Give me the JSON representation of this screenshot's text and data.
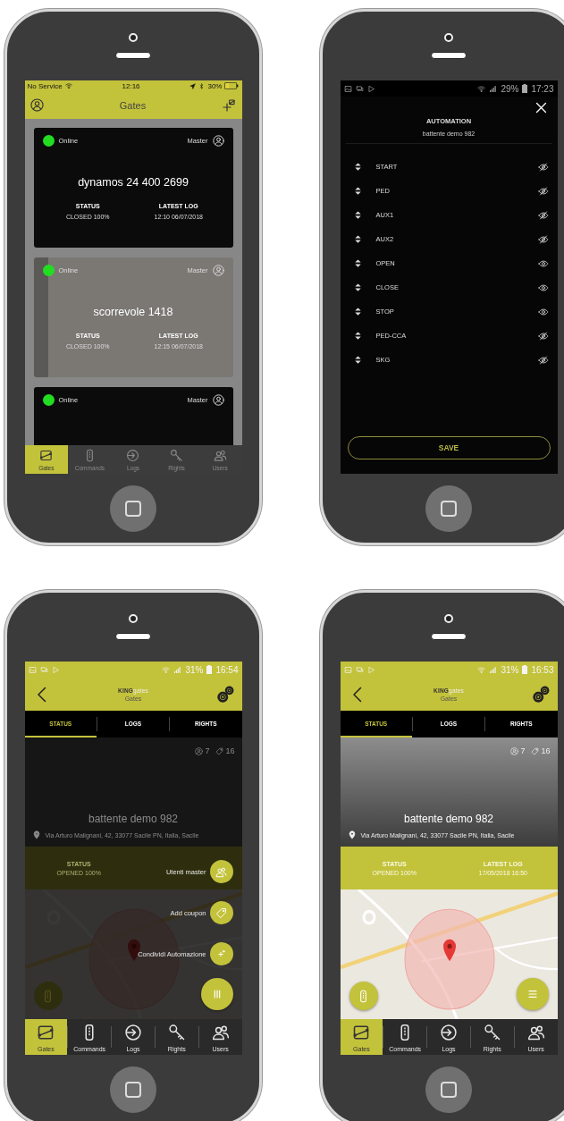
{
  "phones": [
    {
      "kind": "gate-list",
      "status_bar": {
        "carrier": "No Service",
        "time": "12:16",
        "battery": "30%"
      },
      "title": "Gates",
      "cards": [
        {
          "status": "Online",
          "color": "#22dd22",
          "role": "Master",
          "name": "dynamos 24 400 2699",
          "status_label": "STATUS",
          "status_value": "CLOSED 100%",
          "log_label": "LATEST LOG",
          "log_value": "12:10 06/07/2018",
          "photo": false
        },
        {
          "status": "Online",
          "color": "#22dd22",
          "role": "Master",
          "name": "scorrevole 1418",
          "status_label": "STATUS",
          "status_value": "CLOSED 100%",
          "log_label": "LATEST LOG",
          "log_value": "12:15 06/07/2018",
          "photo": true
        },
        {
          "status": "Online",
          "color": "#22dd22",
          "role": "Master",
          "photo": false
        }
      ],
      "tabbar": [
        {
          "kind": "gates",
          "label": "Gates",
          "selected": true
        },
        {
          "kind": "commands",
          "label": "Commands",
          "selected": false
        },
        {
          "kind": "logs",
          "label": "Logs",
          "selected": false
        },
        {
          "kind": "rights",
          "label": "Rights",
          "selected": false
        },
        {
          "kind": "users",
          "label": "Users",
          "selected": false
        }
      ]
    },
    {
      "kind": "automation",
      "status_bar": {
        "battery": "29%",
        "time": "17:23"
      },
      "title": "AUTOMATION",
      "subtitle": "battente demo 982",
      "items": [
        {
          "label": "START",
          "visible": false
        },
        {
          "label": "PED",
          "visible": false
        },
        {
          "label": "AUX1",
          "visible": false
        },
        {
          "label": "AUX2",
          "visible": false
        },
        {
          "label": "OPEN",
          "visible": true
        },
        {
          "label": "CLOSE",
          "visible": true
        },
        {
          "label": "STOP",
          "visible": true
        },
        {
          "label": "PED-CCA",
          "visible": false
        },
        {
          "label": "SKG",
          "visible": false
        }
      ],
      "save": "SAVE"
    },
    {
      "kind": "gate-detail",
      "menu_open": true,
      "status_bar": {
        "battery": "31%",
        "time": "16:54"
      },
      "brand": "**KING**gates",
      "title": "Gates",
      "tabs": [
        {
          "label": "STATUS",
          "selected": true
        },
        {
          "label": "LOGS",
          "selected": false
        },
        {
          "label": "RIGHTS",
          "selected": false
        }
      ],
      "users_count": "7",
      "coupons_count": "16",
      "name": "battente demo 982",
      "address": "Via Arturo Malignani, 42, 33077 Sacile PN, Italia, Sacile",
      "status_label": "STATUS",
      "status_value": "OPENED 100%",
      "menu": [
        {
          "kind": "users",
          "label": "Utenti master"
        },
        {
          "kind": "coupon",
          "label": "Add coupon"
        },
        {
          "kind": "share",
          "label": "Condividi Automazione"
        }
      ],
      "tabbar": [
        {
          "kind": "gates",
          "label": "Gates",
          "selected": true
        },
        {
          "kind": "commands",
          "label": "Commands",
          "selected": false
        },
        {
          "kind": "logs",
          "label": "Logs",
          "selected": false
        },
        {
          "kind": "rights",
          "label": "Rights",
          "selected": false
        },
        {
          "kind": "users",
          "label": "Users",
          "selected": false
        }
      ]
    },
    {
      "kind": "gate-detail",
      "menu_open": false,
      "status_bar": {
        "battery": "31%",
        "time": "16:53"
      },
      "brand": "**KING**gates",
      "title": "Gates",
      "tabs": [
        {
          "label": "STATUS",
          "selected": true
        },
        {
          "label": "LOGS",
          "selected": false
        },
        {
          "label": "RIGHTS",
          "selected": false
        }
      ],
      "users_count": "7",
      "coupons_count": "16",
      "name": "battente demo 982",
      "address": "Via Arturo Malignani, 42, 33077 Sacile PN, Italia, Sacile",
      "status_label": "STATUS",
      "status_value": "OPENED 100%",
      "log_label": "LATEST LOG",
      "log_value": "17/05/2018 16:50",
      "tabbar": [
        {
          "kind": "gates",
          "label": "Gates",
          "selected": true
        },
        {
          "kind": "commands",
          "label": "Commands",
          "selected": false
        },
        {
          "kind": "logs",
          "label": "Logs",
          "selected": false
        },
        {
          "kind": "rights",
          "label": "Rights",
          "selected": false
        },
        {
          "kind": "users",
          "label": "Users",
          "selected": false
        }
      ]
    }
  ]
}
